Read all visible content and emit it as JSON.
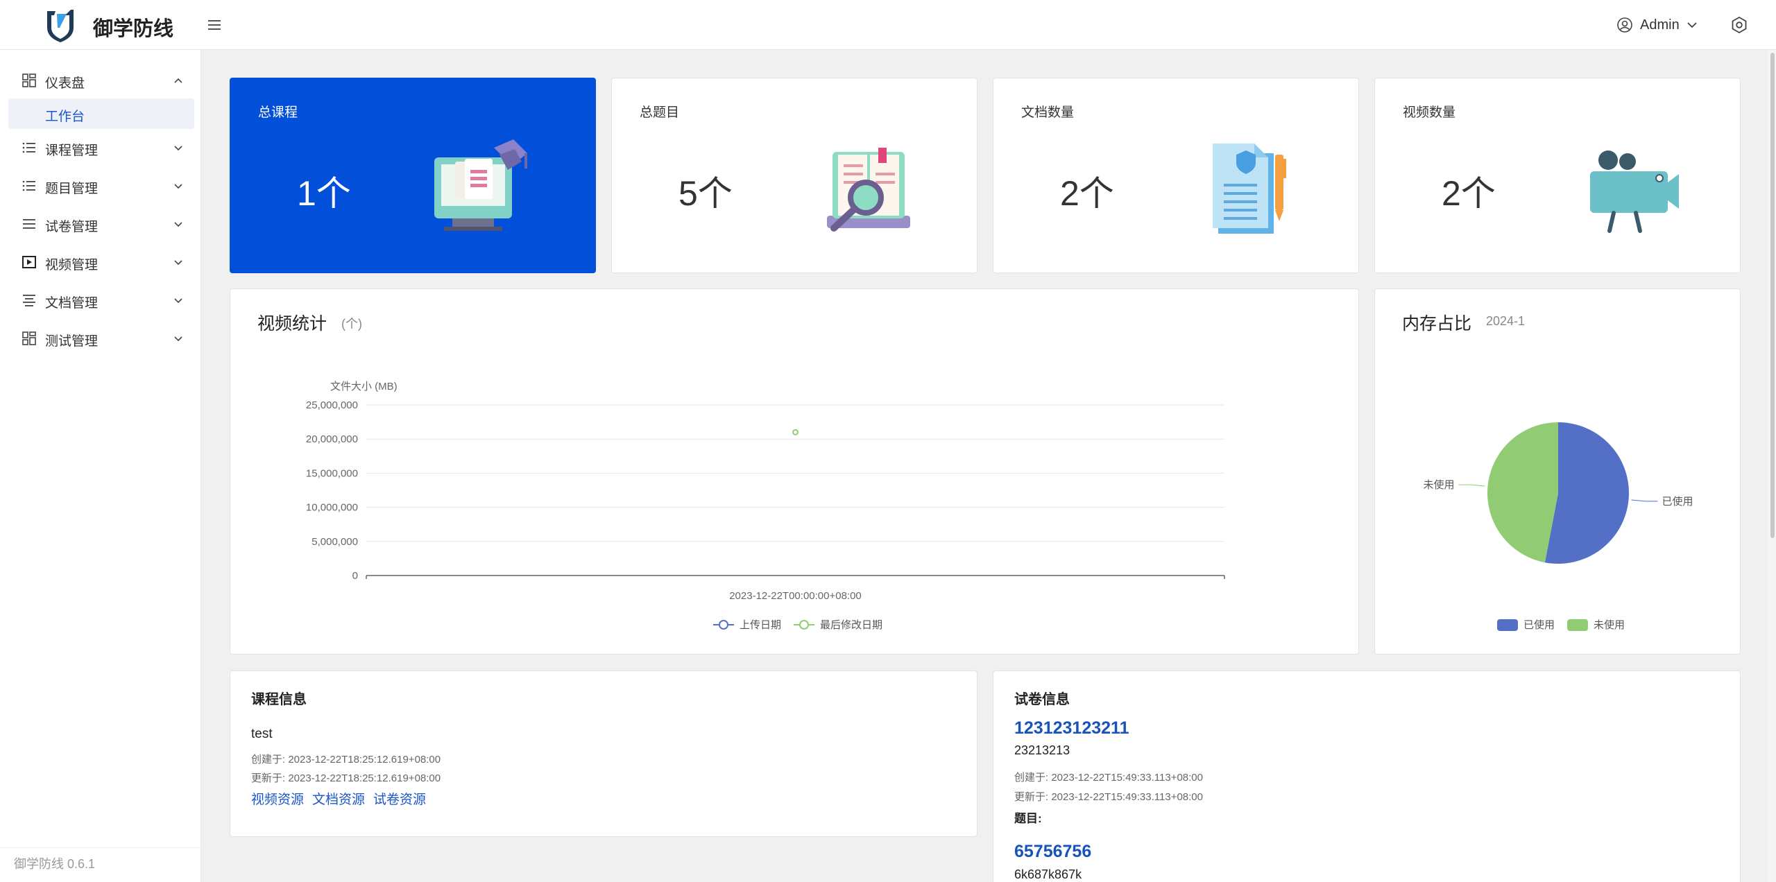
{
  "header": {
    "app_title": "御学防线",
    "user_name": "Admin",
    "logo_icon": "shield-logo-icon",
    "menu_icon": "hamburger-icon",
    "settings_icon": "gear-icon"
  },
  "sidebar": {
    "items": [
      {
        "label": "仪表盘",
        "icon": "dashboard-icon",
        "expanded": true
      },
      {
        "label": "课程管理",
        "icon": "list-icon"
      },
      {
        "label": "题目管理",
        "icon": "list-icon"
      },
      {
        "label": "试卷管理",
        "icon": "menu-lines-icon"
      },
      {
        "label": "视频管理",
        "icon": "video-play-icon"
      },
      {
        "label": "文档管理",
        "icon": "document-lines-icon"
      },
      {
        "label": "测试管理",
        "icon": "dashboard-icon"
      }
    ],
    "sub_item": "工作台",
    "version": "御学防线 0.6.1"
  },
  "stats": [
    {
      "title": "总课程",
      "value": "1个"
    },
    {
      "title": "总题目",
      "value": "5个"
    },
    {
      "title": "文档数量",
      "value": "2个"
    },
    {
      "title": "视频数量",
      "value": "2个"
    }
  ],
  "video_panel": {
    "title": "视频统计",
    "subtitle": "(个)"
  },
  "chart_data": [
    {
      "type": "scatter",
      "ylabel": "文件大小 (MB)",
      "ylim": [
        0,
        25000000
      ],
      "yticks": [
        "25,000,000",
        "20,000,000",
        "15,000,000",
        "10,000,000",
        "5,000,000",
        "0"
      ],
      "categories": [
        "2023-12-22T00:00:00+08:00"
      ],
      "series": [
        {
          "name": "上传日期",
          "color": "#5470c6",
          "values": [
            null
          ]
        },
        {
          "name": "最后修改日期",
          "color": "#91cc75",
          "values": [
            21000000
          ]
        }
      ],
      "legend": "bottom-center"
    },
    {
      "type": "pie",
      "slices": [
        {
          "label": "已使用",
          "value": 53,
          "color": "#5470c6"
        },
        {
          "label": "未使用",
          "value": 47,
          "color": "#91cc75"
        }
      ],
      "legend": "bottom-center"
    }
  ],
  "memory_panel": {
    "title": "内存占比",
    "subtitle": "2024-1"
  },
  "course_info": {
    "title": "课程信息",
    "name": "test",
    "created": "创建于: 2023-12-22T18:25:12.619+08:00",
    "updated": "更新于: 2023-12-22T18:25:12.619+08:00",
    "links": [
      "视频资源",
      "文档资源",
      "试卷资源"
    ]
  },
  "paper_info": {
    "title": "试卷信息",
    "paper_name": "123123123211",
    "paper_desc": "23213213",
    "created": "创建于: 2023-12-22T15:49:33.113+08:00",
    "updated": "更新于: 2023-12-22T15:49:33.113+08:00",
    "questions_label": "题目:",
    "question_name": "65756756",
    "question_desc": "6k687k867k"
  }
}
